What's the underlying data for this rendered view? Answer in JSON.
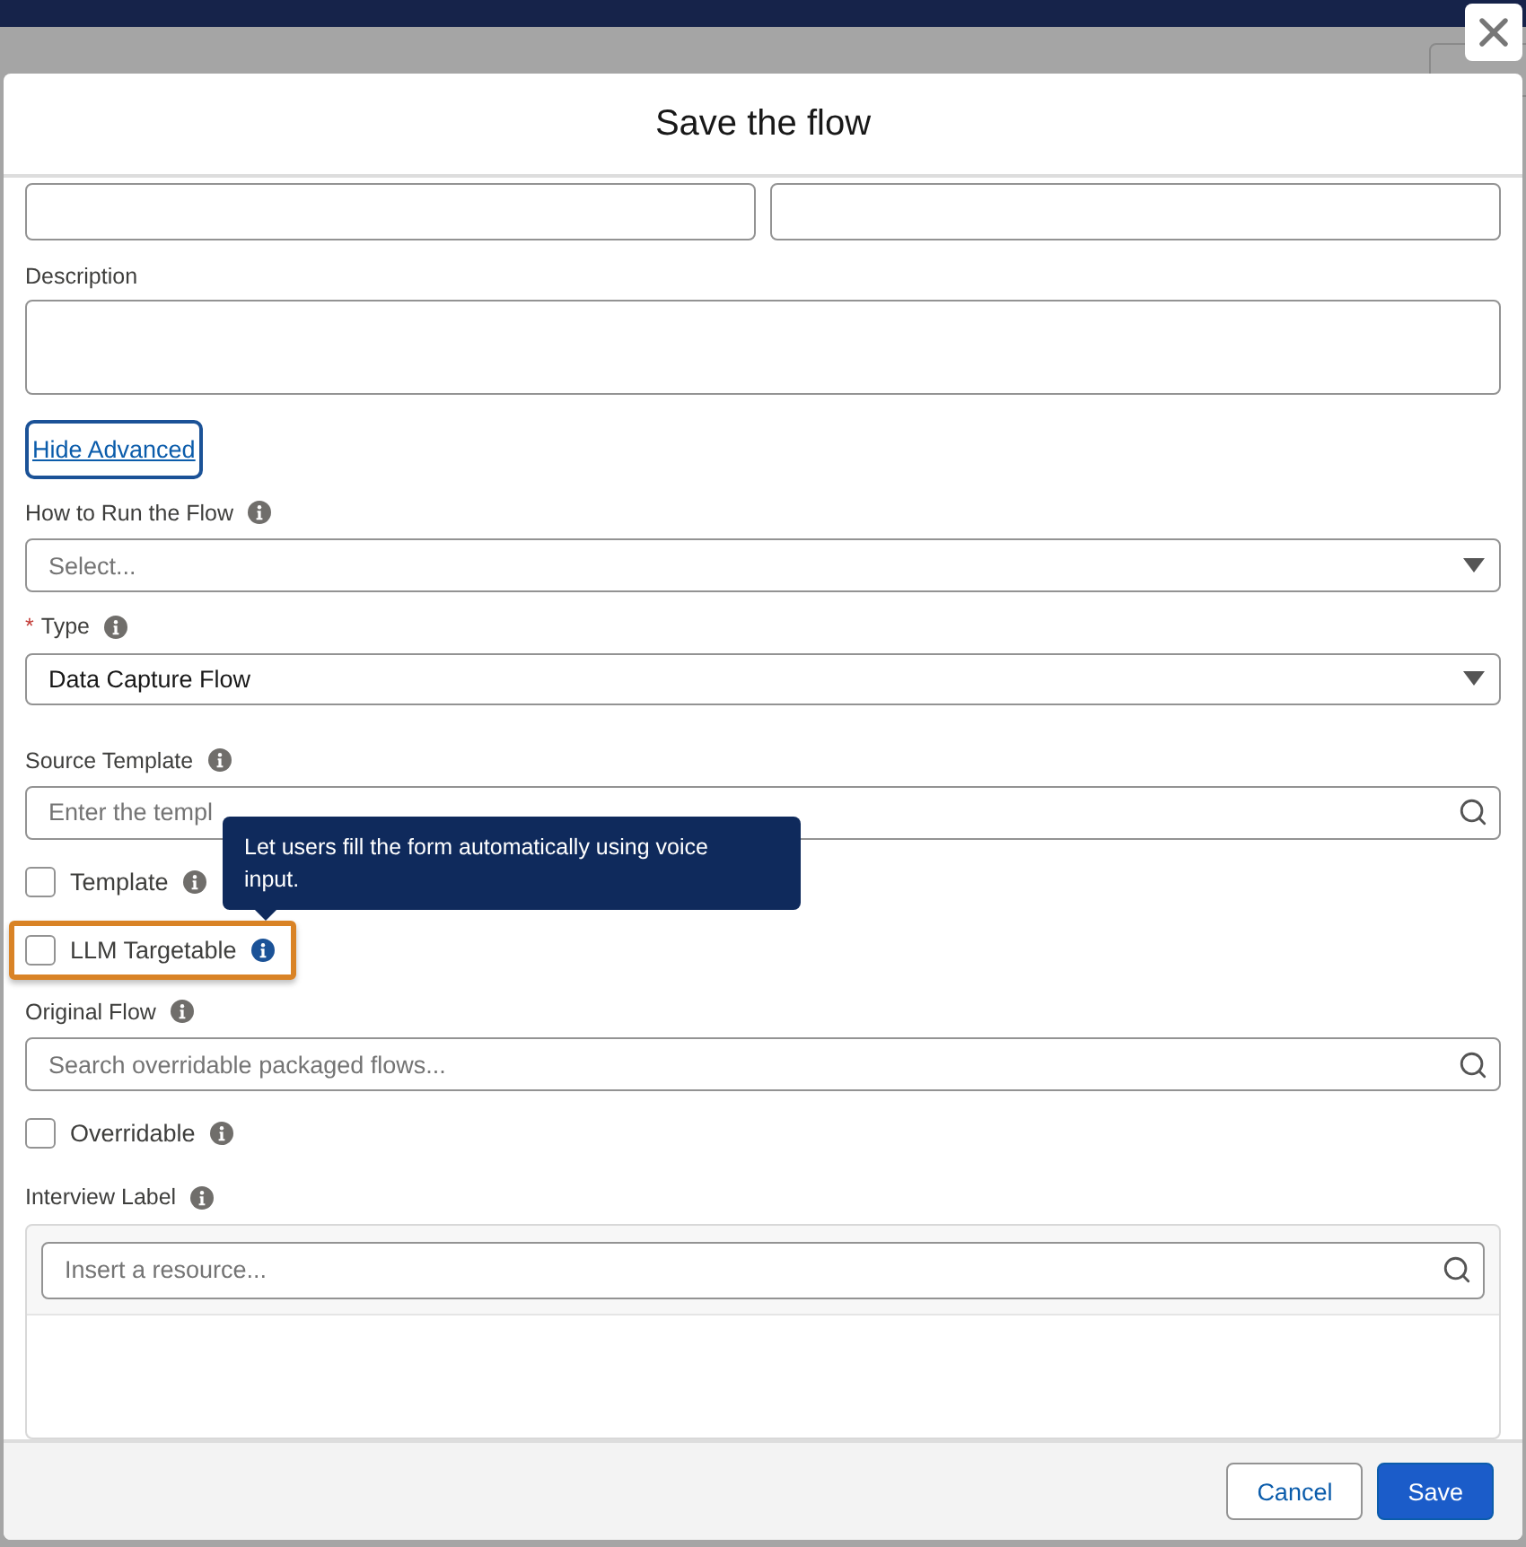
{
  "window": {
    "title": "Save the flow"
  },
  "fields": [
    {
      "kind": "textarea",
      "label": "Description"
    },
    {
      "kind": "link",
      "label": "Hide Advanced"
    },
    {
      "kind": "select",
      "label": "How to Run the Flow",
      "info": true,
      "placeholder": "Select..."
    },
    {
      "kind": "select",
      "label": "Type",
      "required_mark": "*",
      "info": true,
      "value": "Data Capture Flow"
    },
    {
      "kind": "search",
      "label": "Source Template",
      "info": true,
      "placeholder": "Enter the templ"
    },
    {
      "kind": "checkbox",
      "label": "Template",
      "info": true,
      "checked": false
    },
    {
      "kind": "checkbox",
      "label": "LLM Targetable",
      "info": true,
      "checked": false,
      "highlighted": true,
      "tooltip": "Let users fill the form automatically using voice input."
    },
    {
      "kind": "search",
      "label": "Original Flow",
      "info": true,
      "placeholder": "Search overridable packaged flows..."
    },
    {
      "kind": "checkbox",
      "label": "Overridable",
      "info": true,
      "checked": false
    },
    {
      "kind": "resource",
      "label": "Interview Label",
      "info": true,
      "placeholder": "Insert a resource..."
    }
  ],
  "buttons": [
    {
      "label": "Cancel",
      "kind": "neutral"
    },
    {
      "label": "Save",
      "kind": "brand"
    }
  ]
}
